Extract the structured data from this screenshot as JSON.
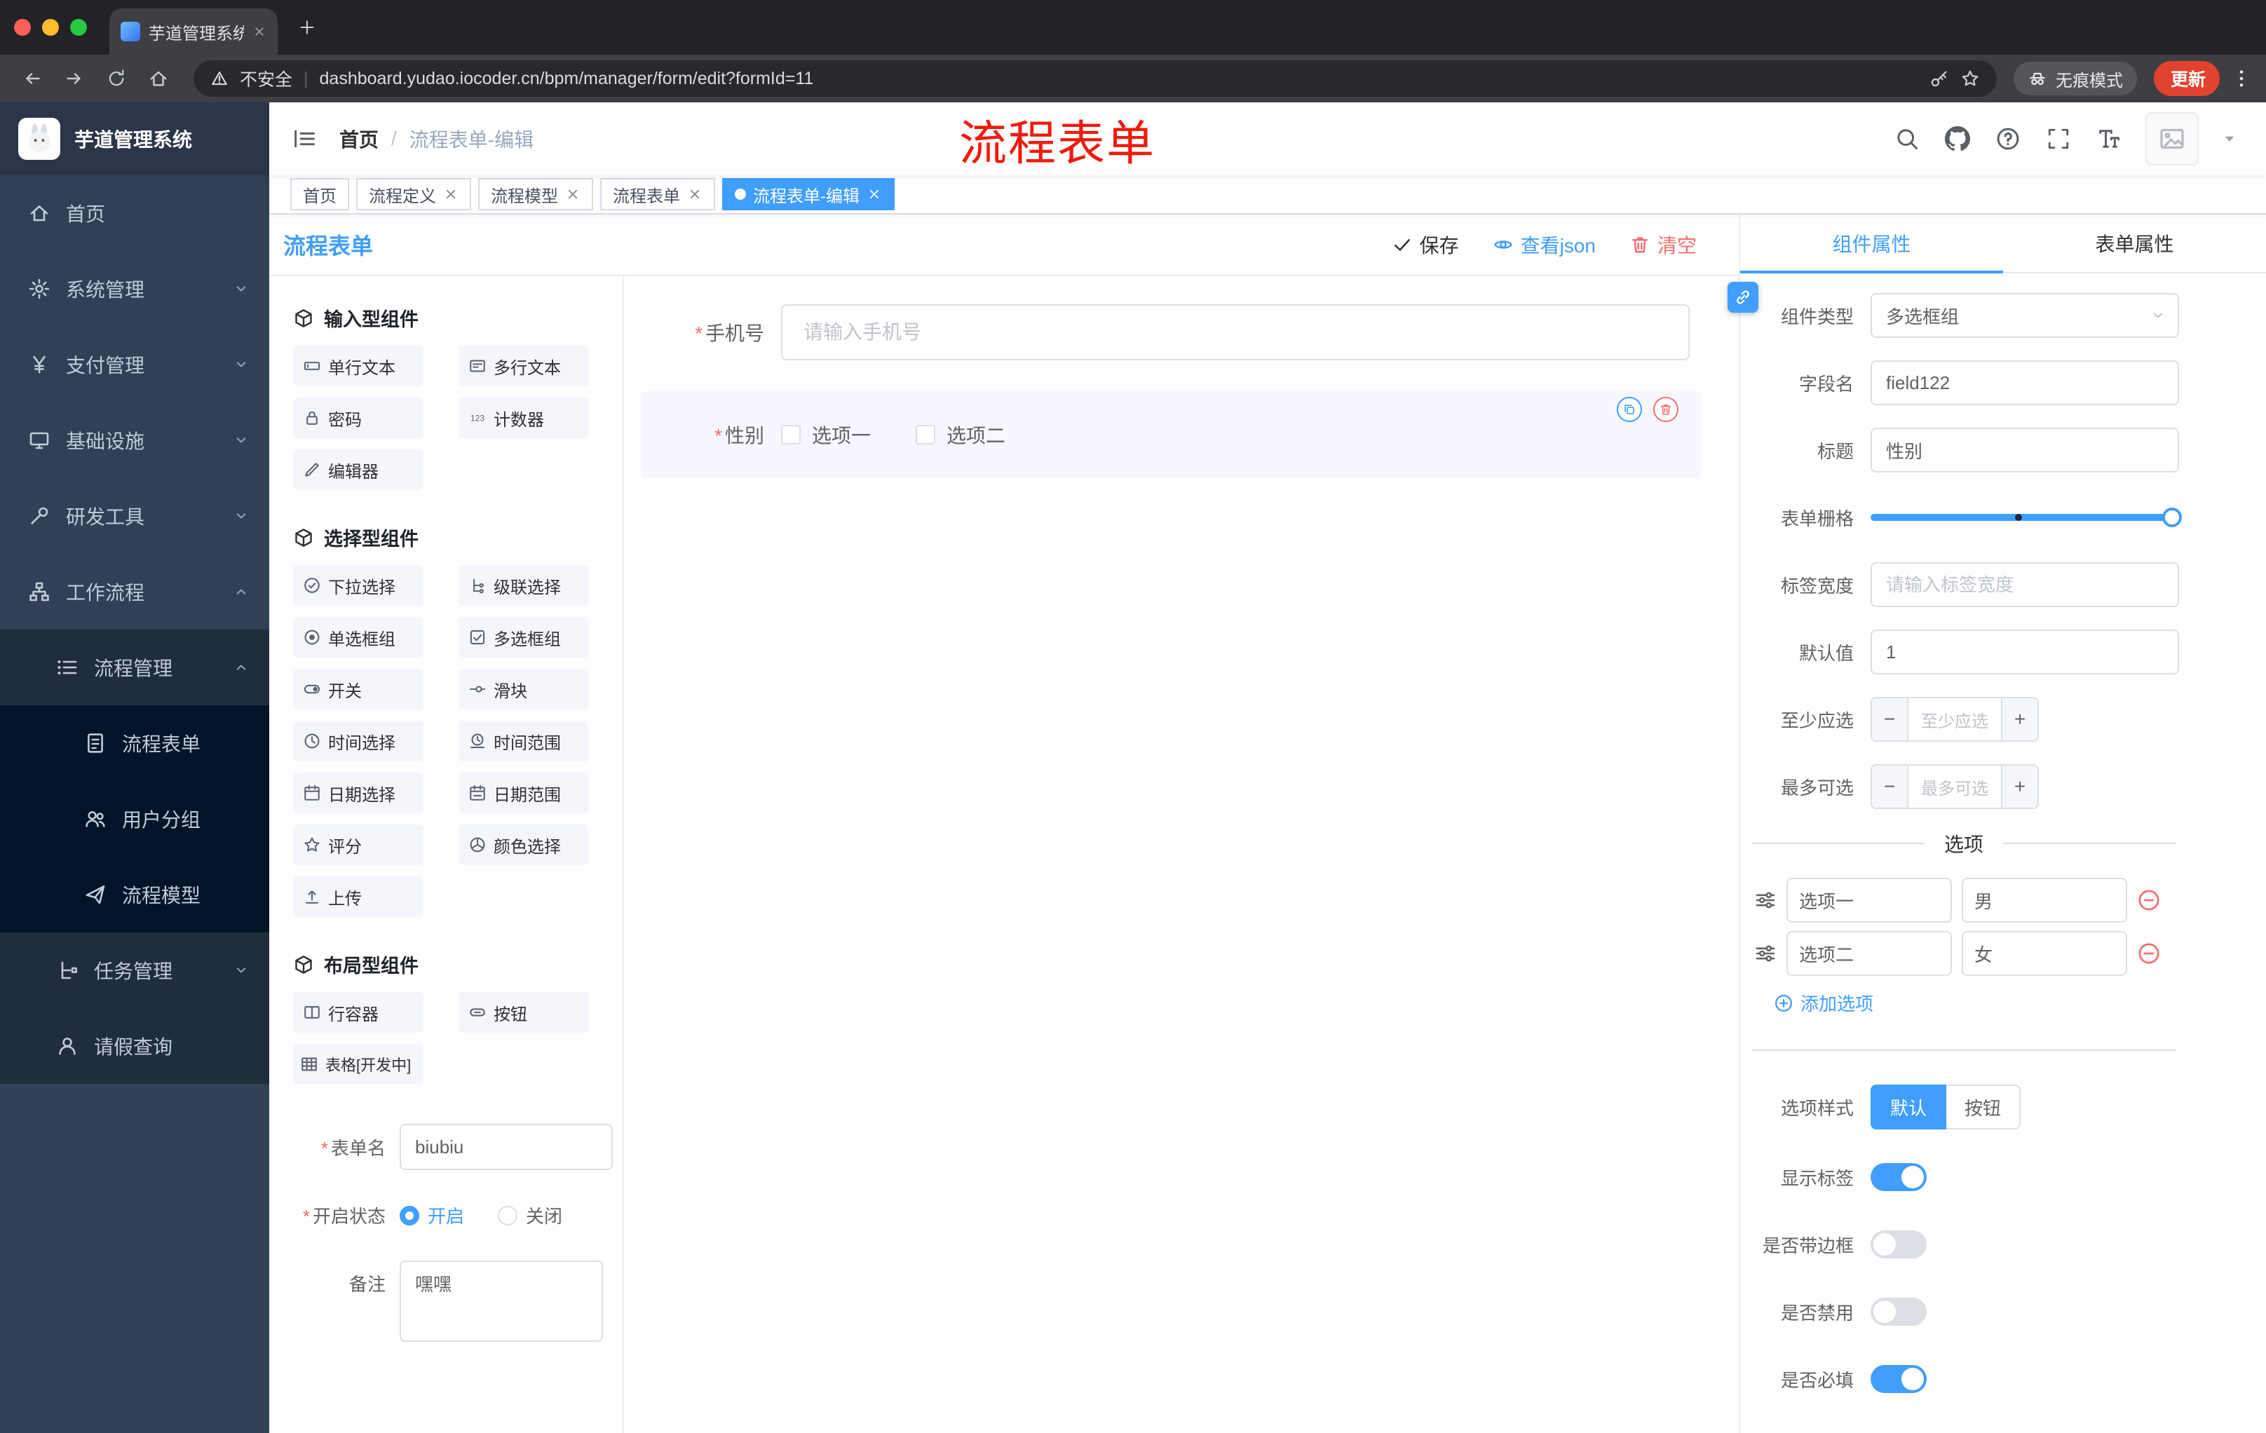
{
  "colors": {
    "accent": "#409eff",
    "danger": "#f56c6c",
    "annotation_red": "#f2190c",
    "active_tag_bg": "#409eff",
    "update_button_bg": "#e1432e",
    "sidebar_bg": "#304156"
  },
  "glyphs": {
    "breadcrumb_sep": "/",
    "url_sep": "|",
    "minus": "−",
    "plus": "+"
  },
  "browser": {
    "tab": {
      "title": "芋道管理系统"
    },
    "address": {
      "security_label": "不安全",
      "url": "dashboard.yudao.iocoder.cn/bpm/manager/form/edit?formId=11"
    },
    "incognito_label": "无痕模式",
    "update_label": "更新"
  },
  "navbar": {
    "breadcrumb": {
      "root": "首页",
      "current": "流程表单-编辑"
    },
    "annotation": "流程表单"
  },
  "tags": {
    "items": [
      {
        "label": "首页"
      },
      {
        "label": "流程定义"
      },
      {
        "label": "流程模型"
      },
      {
        "label": "流程表单"
      },
      {
        "label": "流程表单-编辑"
      }
    ]
  },
  "sidebar": {
    "title": "芋道管理系统",
    "items": [
      {
        "label": "首页"
      },
      {
        "label": "系统管理"
      },
      {
        "label": "支付管理"
      },
      {
        "label": "基础设施"
      },
      {
        "label": "研发工具"
      },
      {
        "label": "工作流程"
      },
      {
        "label": "流程管理"
      },
      {
        "label": "流程表单"
      },
      {
        "label": "用户分组"
      },
      {
        "label": "流程模型"
      },
      {
        "label": "任务管理"
      },
      {
        "label": "请假查询"
      }
    ]
  },
  "designer": {
    "title": "流程表单",
    "actions": {
      "save": "保存",
      "view_json": "查看json",
      "clear": "清空"
    },
    "groups": [
      {
        "title": "输入型组件",
        "items": [
          {
            "label": "单行文本"
          },
          {
            "label": "多行文本"
          },
          {
            "label": "密码"
          },
          {
            "label": "计数器"
          },
          {
            "label": "编辑器"
          }
        ]
      },
      {
        "title": "选择型组件",
        "items": [
          {
            "label": "下拉选择"
          },
          {
            "label": "级联选择"
          },
          {
            "label": "单选框组"
          },
          {
            "label": "多选框组"
          },
          {
            "label": "开关"
          },
          {
            "label": "滑块"
          },
          {
            "label": "时间选择"
          },
          {
            "label": "时间范围"
          },
          {
            "label": "日期选择"
          },
          {
            "label": "日期范围"
          },
          {
            "label": "评分"
          },
          {
            "label": "颜色选择"
          },
          {
            "label": "上传"
          }
        ]
      },
      {
        "title": "布局型组件",
        "items": [
          {
            "label": "行容器"
          },
          {
            "label": "按钮"
          },
          {
            "label": "表格[开发中]"
          }
        ]
      }
    ],
    "meta": {
      "form_name_label": "表单名",
      "form_name_value": "biubiu",
      "status_label": "开启状态",
      "status_on": "开启",
      "status_off": "关闭",
      "remark_label": "备注",
      "remark_value": "嘿嘿"
    },
    "canvas": {
      "phone": {
        "label": "手机号",
        "placeholder": "请输入手机号"
      },
      "gender": {
        "label": "性别",
        "option1": "选项一",
        "option2": "选项二"
      }
    }
  },
  "props": {
    "tab_component": "组件属性",
    "tab_form": "表单属性",
    "component_type_label": "组件类型",
    "component_type_value": "多选框组",
    "field_name_label": "字段名",
    "field_name_value": "field122",
    "title_label": "标题",
    "title_value": "性别",
    "grid_label": "表单栅格",
    "label_width_label": "标签宽度",
    "label_width_placeholder": "请输入标签宽度",
    "default_label": "默认值",
    "default_value": "1",
    "min_label": "至少应选",
    "min_placeholder": "至少应选",
    "max_label": "最多可选",
    "max_placeholder": "最多可选",
    "options_title": "选项",
    "options": [
      {
        "label": "选项一",
        "value": "男"
      },
      {
        "label": "选项二",
        "value": "女"
      }
    ],
    "add_option": "添加选项",
    "style_label": "选项样式",
    "style_default": "默认",
    "style_button": "按钮",
    "switch_show_label": "显示标签",
    "switch_border": "是否带边框",
    "switch_disabled": "是否禁用",
    "switch_required": "是否必填"
  }
}
